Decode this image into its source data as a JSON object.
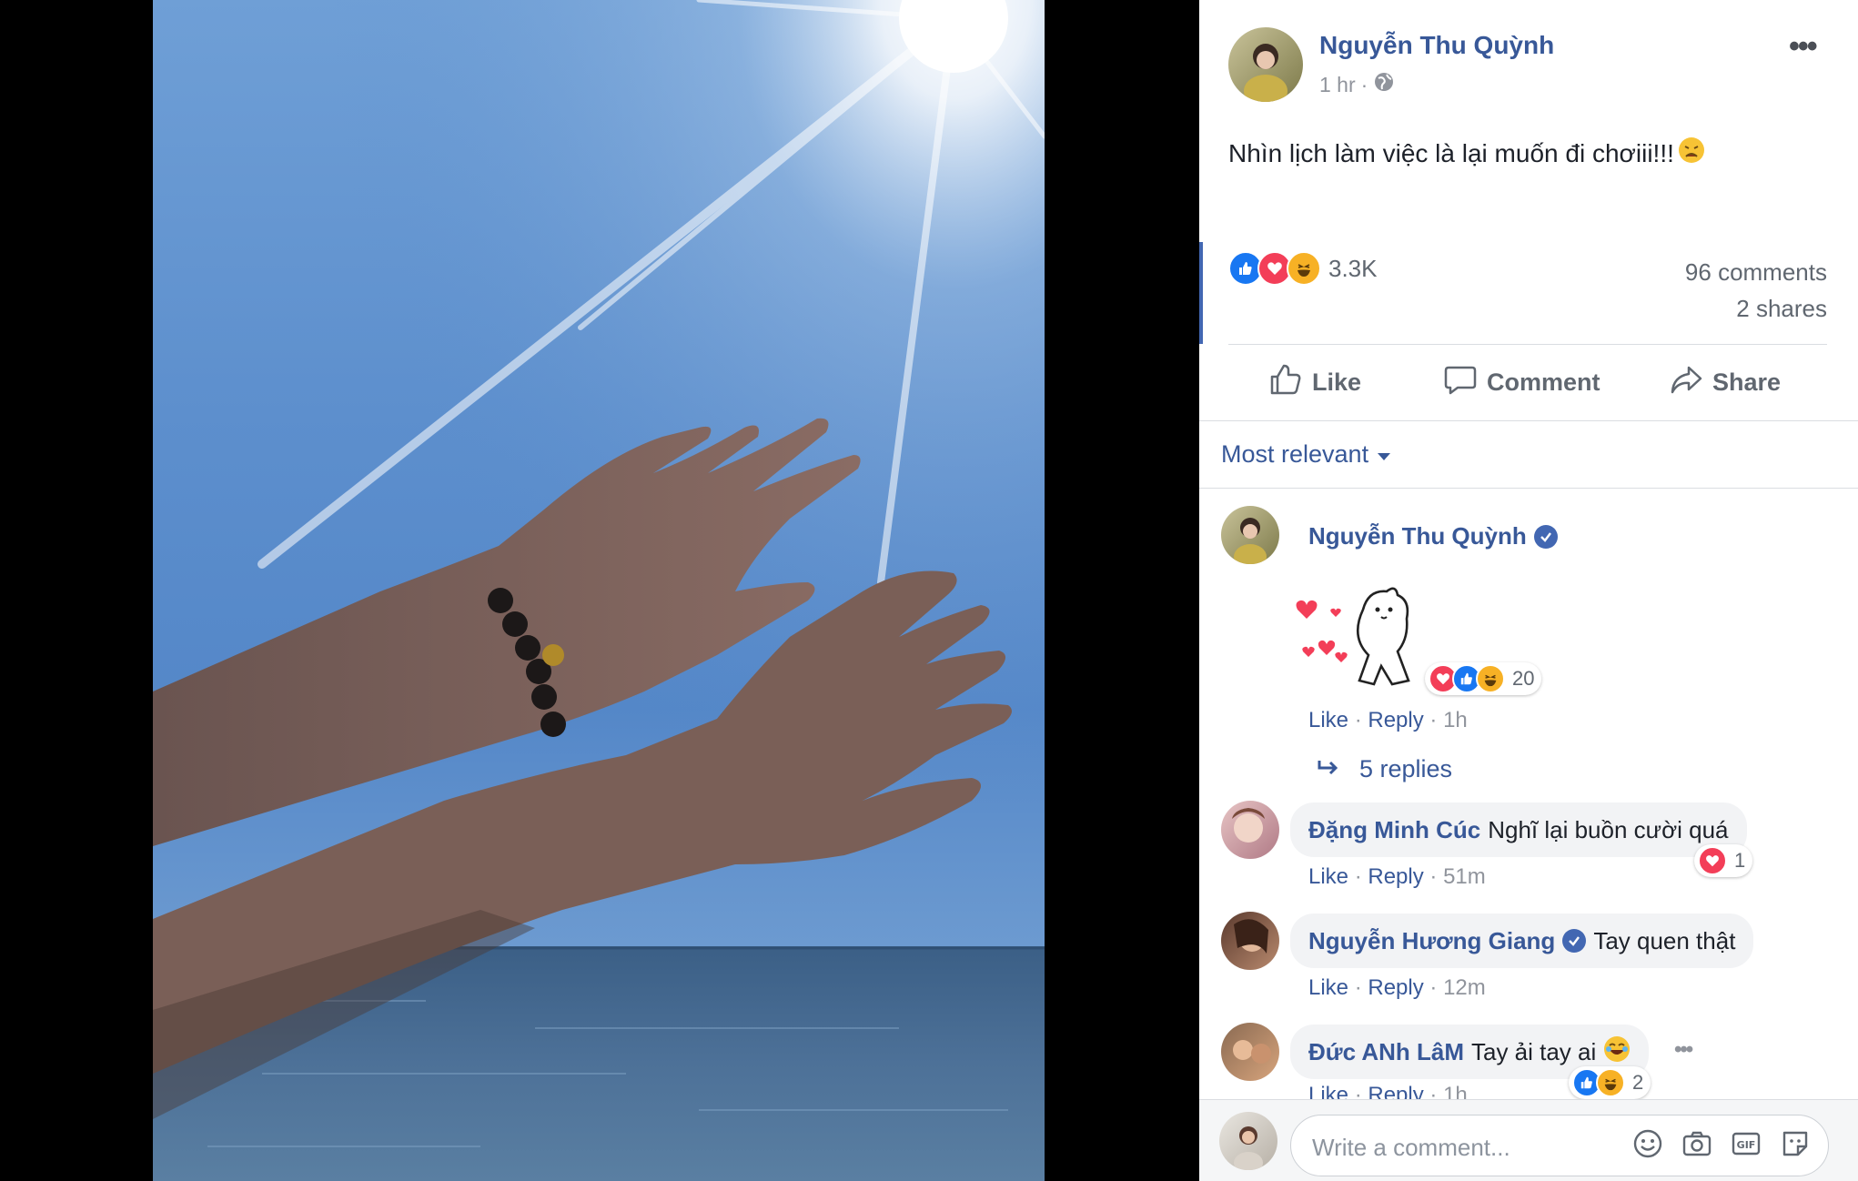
{
  "post": {
    "author": "Nguyễn Thu Quỳnh",
    "time": "1 hr",
    "text": "Nhìn lịch làm việc là lại muốn đi chơiii!!!",
    "reaction_count": "3.3K",
    "comments_count": "96 comments",
    "shares_count": "2 shares"
  },
  "actions": {
    "like": "Like",
    "comment": "Comment",
    "share": "Share"
  },
  "sort_label": "Most relevant",
  "comments": [
    {
      "author": "Nguyễn Thu Quỳnh",
      "text": "",
      "verified": true,
      "reactions": "20",
      "like": "Like",
      "reply": "Reply",
      "time": "1h"
    },
    {
      "author": "Đặng Minh Cúc",
      "text": "Nghĩ lại buồn cười quá",
      "reactions": "1",
      "like": "Like",
      "reply": "Reply",
      "time": "51m"
    },
    {
      "author": "Nguyễn Hương Giang",
      "text": "Tay quen thật",
      "verified": true,
      "like": "Like",
      "reply": "Reply",
      "time": "12m"
    },
    {
      "author": "Đức ANh LâM",
      "text": "Tay ải tay ai",
      "reactions": "2",
      "like": "Like",
      "reply": "Reply",
      "time": "1h"
    }
  ],
  "replies_label": "5 replies",
  "composer_placeholder": "Write a comment...",
  "colors": {
    "link": "#385898",
    "like_blue": "#1877f2",
    "love_red": "#f33e58",
    "haha_yellow": "#f7b125"
  },
  "icons": [
    "more-icon",
    "globe-icon",
    "like-outline-icon",
    "comment-outline-icon",
    "share-outline-icon",
    "reply-arrow-icon",
    "emoji-icon",
    "camera-icon",
    "gif-icon",
    "sticker-icon",
    "verified-icon"
  ]
}
